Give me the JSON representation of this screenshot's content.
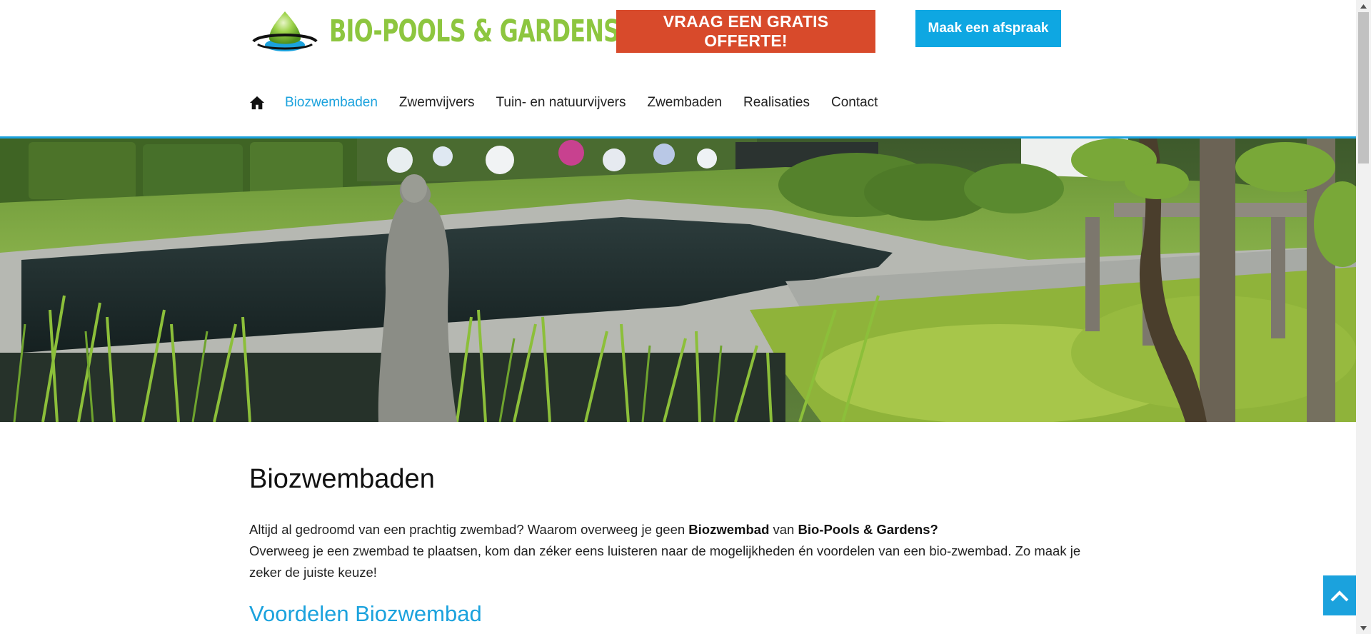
{
  "header": {
    "logo_text": "BIO-POOLS & GARDENS",
    "cta_primary": "VRAAG EEN GRATIS OFFERTE!",
    "cta_secondary": "Maak een afspraak"
  },
  "nav": {
    "items": [
      {
        "label": "Biozwembaden",
        "active": true
      },
      {
        "label": "Zwemvijvers"
      },
      {
        "label": "Tuin- en natuurvijvers"
      },
      {
        "label": "Zwembaden"
      },
      {
        "label": "Realisaties"
      },
      {
        "label": "Contact"
      }
    ]
  },
  "content": {
    "title": "Biozwembaden",
    "intro_1": "Altijd al gedroomd van een prachtig zwembad? Waarom overweeg je geen ",
    "intro_bold_1": "Biozwembad",
    "intro_2": " van ",
    "intro_bold_2": "Bio-Pools & Gardens?",
    "intro_3": "Overweeg je een zwembad te plaatsen, kom dan zéker eens luisteren naar de mogelijkheden én voordelen van een bio-zwembad. Zo maak je zeker de juiste keuze!",
    "subtitle": "Voordelen Biozwembad"
  },
  "colors": {
    "accent": "#1ba2dd",
    "cta_red": "#d84a2b",
    "logo_green": "#8dc63f"
  }
}
